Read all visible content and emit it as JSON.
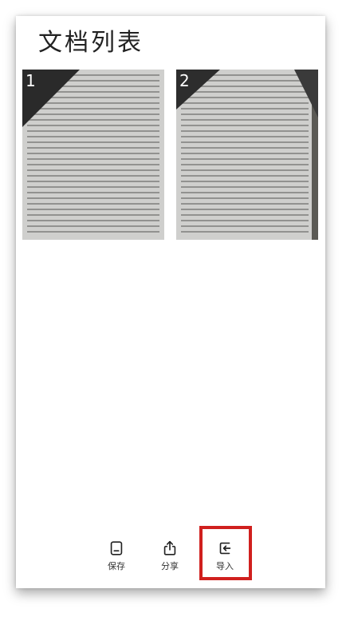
{
  "header": {
    "title": "文档列表"
  },
  "documents": [
    {
      "number": "1"
    },
    {
      "number": "2"
    }
  ],
  "toolbar": {
    "save_label": "保存",
    "share_label": "分享",
    "import_label": "导入"
  },
  "colors": {
    "highlight": "#d0201e",
    "text": "#222222",
    "background": "#ffffff"
  },
  "icons": {
    "save": "save-icon",
    "share": "share-icon",
    "import": "import-icon"
  }
}
